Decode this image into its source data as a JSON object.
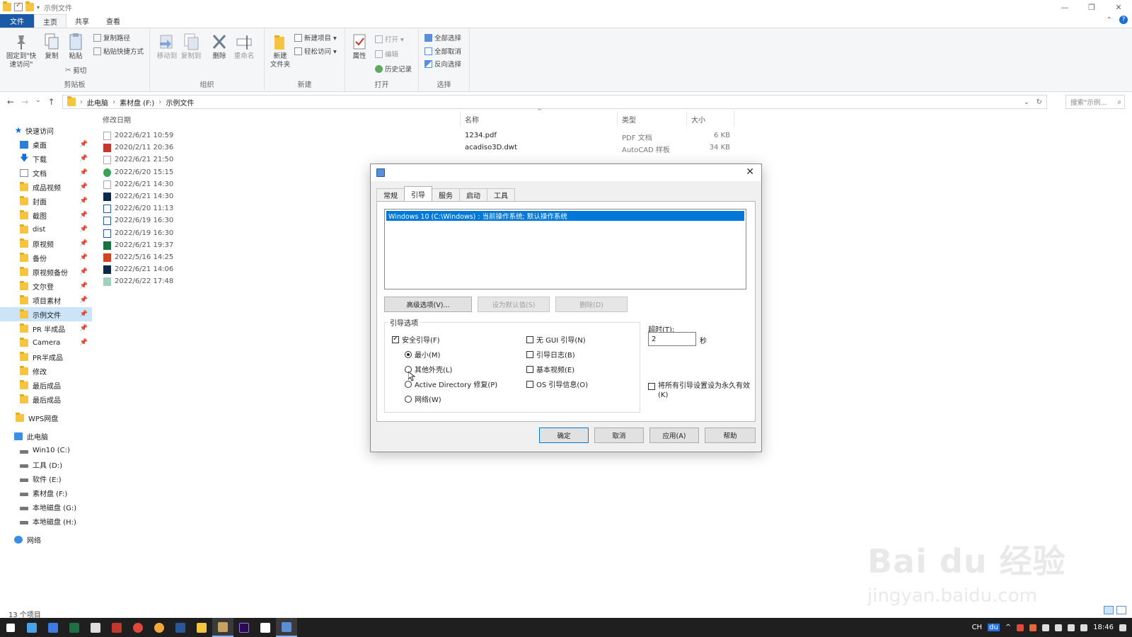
{
  "window": {
    "title": "示例文件",
    "controls": [
      "—",
      "❐",
      "✕"
    ]
  },
  "ribbon": {
    "tabs": [
      "文件",
      "主页",
      "共享",
      "查看"
    ],
    "active_tab": "主页",
    "groups": {
      "clipboard": {
        "label": "剪贴板",
        "pin": "固定到\"快\n速访问\"",
        "copy": "复制",
        "paste": "粘贴",
        "copy_path": "复制路径",
        "paste_shortcut": "粘贴快捷方式",
        "cut": "剪切"
      },
      "organize": {
        "label": "组织",
        "move_to": "移动到",
        "copy_to": "复制到",
        "delete": "删除",
        "rename": "重命名"
      },
      "new": {
        "label": "新建",
        "new_folder": "新建\n文件夹",
        "new_item": "新建项目 ▾",
        "easy_access": "轻松访问 ▾"
      },
      "open": {
        "label": "打开",
        "properties": "属性",
        "open": "打开 ▾",
        "edit": "编辑",
        "history": "历史记录"
      },
      "select": {
        "label": "选择",
        "select_all": "全部选择",
        "select_none": "全部取消",
        "invert": "反向选择"
      }
    }
  },
  "address": {
    "crumbs": [
      "此电脑",
      "素材盘 (F:)",
      "示例文件"
    ],
    "search_placeholder": "搜索\"示例..."
  },
  "sidebar": {
    "quick_access": "快速访问",
    "items": [
      "桌面",
      "下载",
      "文档",
      "成品视频",
      "封面",
      "截图",
      "dist",
      "原视频",
      "备份",
      "原视频备份",
      "文尔登",
      "项目素材",
      "示例文件",
      "PR 半成品",
      "Camera",
      "PR半成品",
      "修改",
      "最后成品",
      "最后成品"
    ],
    "pinned_count": 15,
    "selected": "示例文件",
    "wps": "WPS网盘",
    "this_pc": "此电脑",
    "drives": [
      "Win10 (C:)",
      "工具 (D:)",
      "软件 (E:)",
      "素材盘 (F:)",
      "本地磁盘 (G:)",
      "本地磁盘 (H:)"
    ],
    "network": "网络"
  },
  "filelist": {
    "columns": {
      "date": "修改日期",
      "name": "名称",
      "type": "类型",
      "size": "大小"
    },
    "rows": [
      {
        "date": "2022/6/21 10:59",
        "name": "1234.pdf",
        "type": "PDF 文档",
        "size": "6 KB",
        "icon": "pdf-icon"
      },
      {
        "date": "2020/2/11 20:36",
        "name": "acadiso3D.dwt",
        "type": "AutoCAD 样板",
        "size": "34 KB",
        "icon": "dwt-icon"
      },
      {
        "date": "2022/6/21 21:50",
        "name": "",
        "type": "",
        "size": "",
        "icon": "file-icon"
      },
      {
        "date": "2022/6/20 15:15",
        "name": "",
        "type": "",
        "size": "",
        "icon": "web-icon"
      },
      {
        "date": "2022/6/21 14:30",
        "name": "",
        "type": "",
        "size": "",
        "icon": "file-icon"
      },
      {
        "date": "2022/6/21 14:30",
        "name": "",
        "type": "",
        "size": "",
        "icon": "ps-icon"
      },
      {
        "date": "2022/6/20 11:13",
        "name": "",
        "type": "",
        "size": "",
        "icon": "word-icon"
      },
      {
        "date": "2022/6/19 16:30",
        "name": "",
        "type": "",
        "size": "",
        "icon": "word-icon"
      },
      {
        "date": "2022/6/19 16:30",
        "name": "",
        "type": "",
        "size": "",
        "icon": "word-icon"
      },
      {
        "date": "2022/6/21 19:37",
        "name": "",
        "type": "",
        "size": "",
        "icon": "excel-icon"
      },
      {
        "date": "2022/5/16 14:25",
        "name": "",
        "type": "",
        "size": "",
        "icon": "ppt-icon"
      },
      {
        "date": "2022/6/21 14:06",
        "name": "",
        "type": "",
        "size": "",
        "icon": "ps-icon"
      },
      {
        "date": "2022/6/22 17:48",
        "name": "",
        "type": "",
        "size": "",
        "icon": "image-icon"
      }
    ]
  },
  "status": {
    "count": "13 个项目"
  },
  "taskbar": {
    "lang": "CH",
    "ime": "du",
    "time": "18:46"
  },
  "dialog": {
    "tabs": [
      "常规",
      "引导",
      "服务",
      "启动",
      "工具"
    ],
    "active_tab": "引导",
    "os_entry": "Windows 10 (C:\\Windows) : 当前操作系统; 默认操作系统",
    "buttons": {
      "advanced": "高级选项(V)...",
      "set_default": "设为默认值(S)",
      "delete": "删除(D)"
    },
    "boot_options_label": "引导选项",
    "safe_boot": "安全引导(F)",
    "safe_boot_checked": true,
    "radios": [
      "最小(M)",
      "其他外壳(L)",
      "Active Directory 修复(P)",
      "网络(W)"
    ],
    "radio_selected": 0,
    "checks": [
      "无 GUI 引导(N)",
      "引导日志(B)",
      "基本视频(E)",
      "OS 引导信息(O)"
    ],
    "timeout_label": "超时(T):",
    "timeout_value": "2",
    "timeout_unit": "秒",
    "permanent": "将所有引导设置设为永久有效(K)",
    "footer": {
      "ok": "确定",
      "cancel": "取消",
      "apply": "应用(A)",
      "help": "帮助"
    }
  },
  "watermark": {
    "main": "Bai du 经验",
    "sub": "jingyan.baidu.com"
  },
  "colors": {
    "accent": "#0078d7",
    "file_tab": "#1a5aa6",
    "selected_row": "#cce4f7",
    "taskbar": "#1f1f1f"
  }
}
